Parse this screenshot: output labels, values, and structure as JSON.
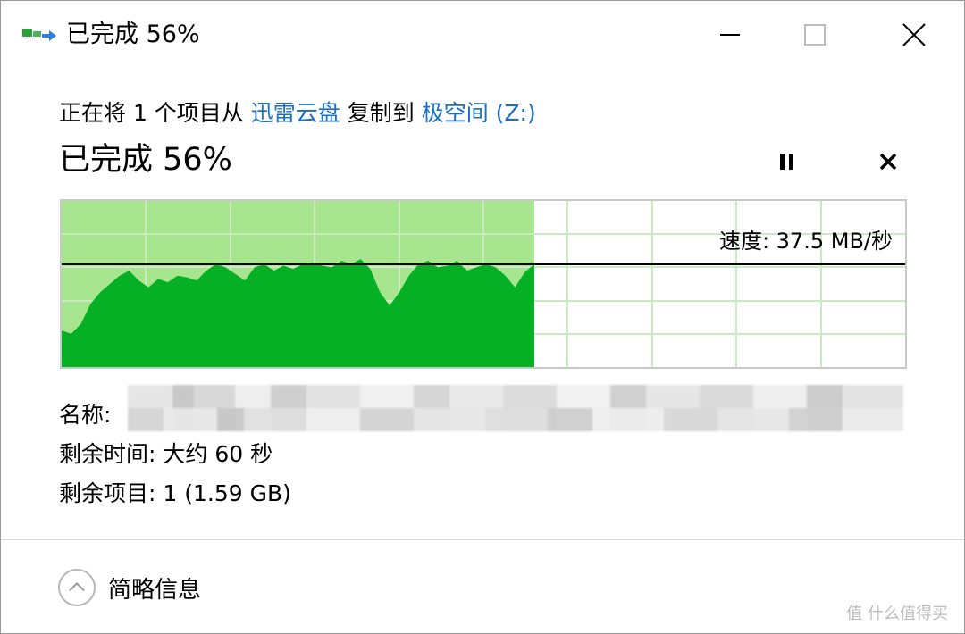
{
  "window": {
    "title": "已完成 56%",
    "buttons": [
      "minimize",
      "maximize",
      "close"
    ]
  },
  "copy": {
    "prefix": "正在将 1 个项目从",
    "source": "迅雷云盘",
    "middle": "复制到",
    "destination": "极空间 (Z:)"
  },
  "progress": {
    "heading": "已完成 56%",
    "percent": 56,
    "speed_label": "速度: 37.5 MB/秒",
    "colors": {
      "fill_light": "#a8e58f",
      "fill_dark": "#06b025",
      "grid": "#c8ecc0",
      "line": "#000000"
    }
  },
  "details": {
    "name_label": "名称:",
    "time_label": "剩余时间: 大约 60 秒",
    "items_label": "剩余项目: 1 (1.59 GB)"
  },
  "footer": {
    "toggle_label": "简略信息"
  },
  "watermark": "值 什么值得买"
}
